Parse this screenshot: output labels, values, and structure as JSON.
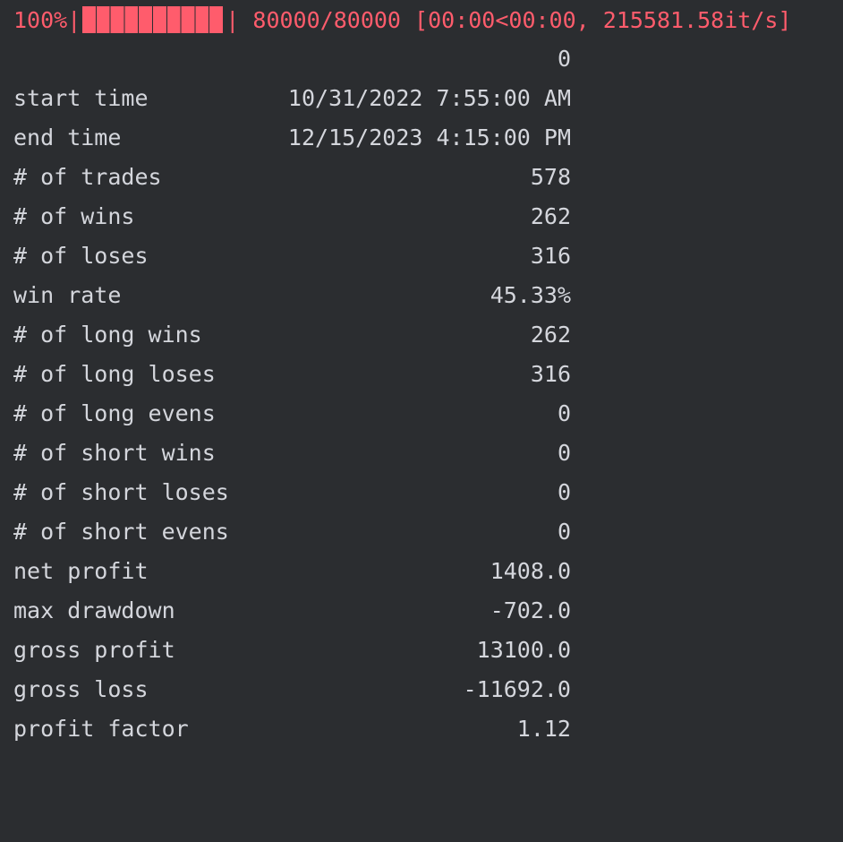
{
  "progress": {
    "percent_text": "100%",
    "fraction": 1.0,
    "counter": "80000/80000",
    "timing": "[00:00<00:00, 215581.58it/s]"
  },
  "table": {
    "column_header": "0",
    "rows": [
      {
        "label": "start time",
        "value": "10/31/2022 7:55:00 AM"
      },
      {
        "label": "end time",
        "value": "12/15/2023 4:15:00 PM"
      },
      {
        "label": "# of trades",
        "value": "578"
      },
      {
        "label": "# of wins",
        "value": "262"
      },
      {
        "label": "# of loses",
        "value": "316"
      },
      {
        "label": "win rate",
        "value": "45.33%"
      },
      {
        "label": "# of long wins",
        "value": "262"
      },
      {
        "label": "# of long loses",
        "value": "316"
      },
      {
        "label": "# of long evens",
        "value": "0"
      },
      {
        "label": "# of short wins",
        "value": "0"
      },
      {
        "label": "# of short loses",
        "value": "0"
      },
      {
        "label": "# of short evens",
        "value": "0"
      },
      {
        "label": "net profit",
        "value": "1408.0"
      },
      {
        "label": "max drawdown",
        "value": "-702.0"
      },
      {
        "label": "gross profit",
        "value": "13100.0"
      },
      {
        "label": "gross loss",
        "value": "-11692.0"
      },
      {
        "label": "profit factor",
        "value": "1.12"
      }
    ]
  },
  "colors": {
    "background": "#2b2d30",
    "text": "#d4d6dc",
    "progress": "#ff5c6c"
  }
}
